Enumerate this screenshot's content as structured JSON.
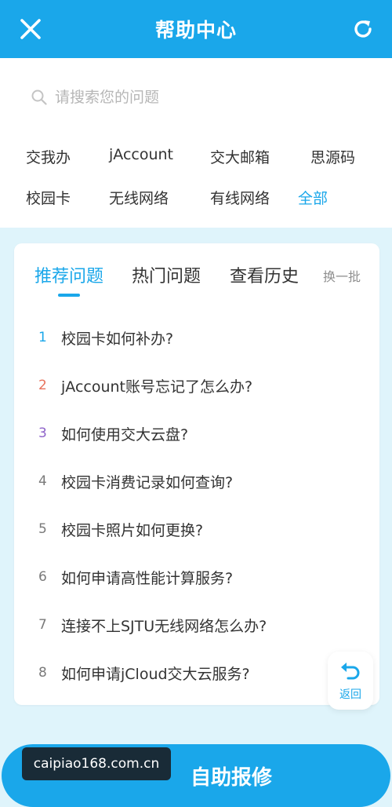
{
  "header": {
    "title": "帮助中心"
  },
  "search": {
    "placeholder": "请搜索您的问题"
  },
  "quick_links": [
    {
      "label": "交我办"
    },
    {
      "label": "jAccount"
    },
    {
      "label": "交大邮箱"
    },
    {
      "label": "思源码"
    },
    {
      "label": "校园卡"
    },
    {
      "label": "无线网络"
    },
    {
      "label": "有线网络"
    },
    {
      "label": "全部"
    }
  ],
  "tabs": [
    {
      "label": "推荐问题",
      "active": true
    },
    {
      "label": "热门问题",
      "active": false
    },
    {
      "label": "查看历史",
      "active": false
    }
  ],
  "refresh_batch": "换一批",
  "questions": [
    {
      "num": "1",
      "text": "校园卡如何补办?",
      "color": "#1aa7ea"
    },
    {
      "num": "2",
      "text": "jAccount账号忘记了怎么办?",
      "color": "#e8725c"
    },
    {
      "num": "3",
      "text": "如何使用交大云盘?",
      "color": "#8d62c9"
    },
    {
      "num": "4",
      "text": "校园卡消费记录如何查询?",
      "color": "#7a7a7a"
    },
    {
      "num": "5",
      "text": "校园卡照片如何更换?",
      "color": "#7a7a7a"
    },
    {
      "num": "6",
      "text": "如何申请高性能计算服务?",
      "color": "#7a7a7a"
    },
    {
      "num": "7",
      "text": "连接不上SJTU无线网络怎么办?",
      "color": "#7a7a7a"
    },
    {
      "num": "8",
      "text": "如何申请jCloud交大云服务?",
      "color": "#7a7a7a"
    }
  ],
  "back_button": {
    "label": "返回"
  },
  "repair_button": {
    "label": "自助报修"
  },
  "watermark": {
    "text": "caipiao168.com.cn"
  },
  "colors": {
    "accent": "#1aa7ea",
    "background": "#dff4fb"
  },
  "icons": {
    "close": "close-icon",
    "refresh": "refresh-icon",
    "search": "search-icon",
    "back": "back-arrow-icon"
  }
}
